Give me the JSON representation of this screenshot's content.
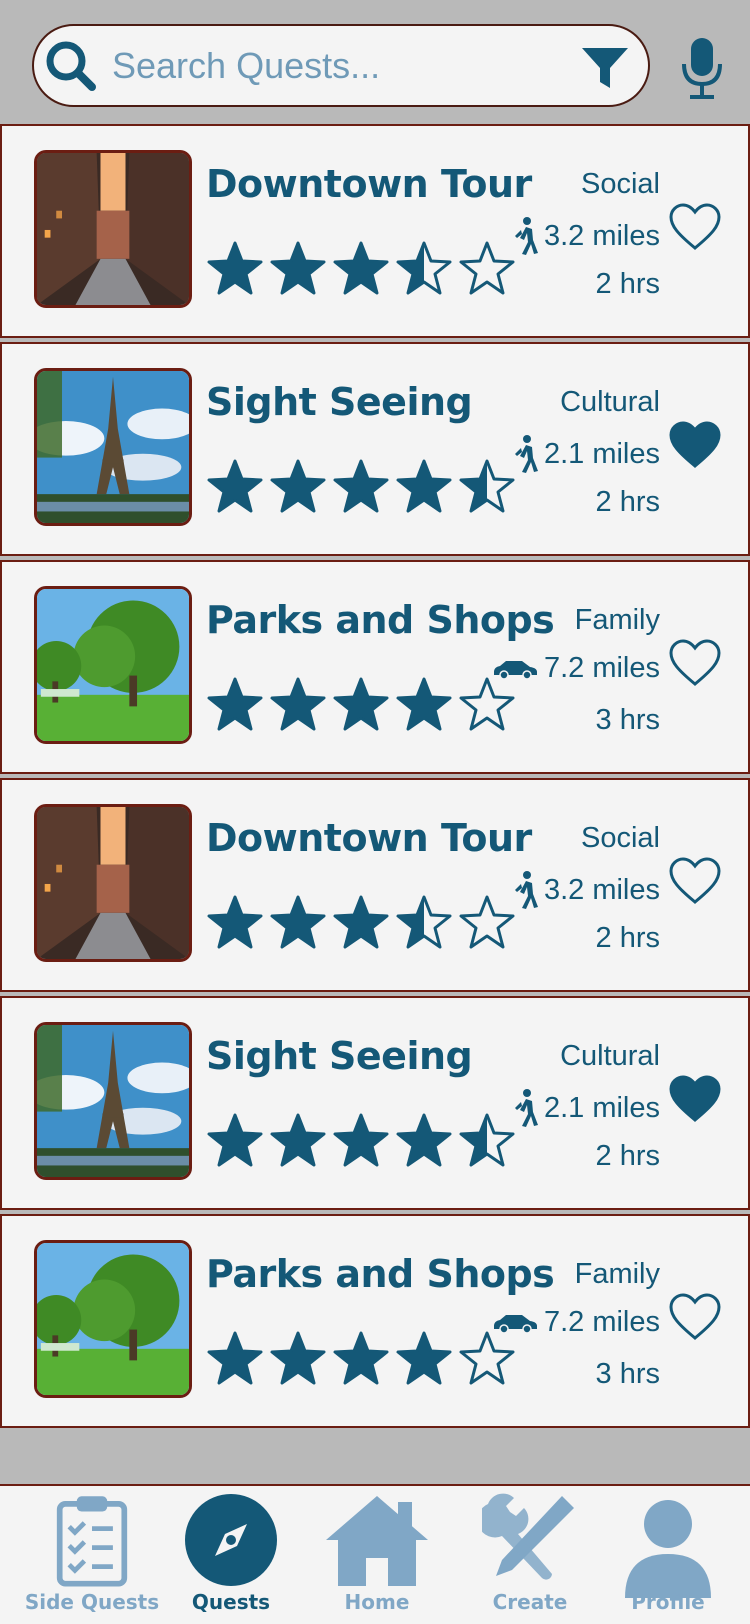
{
  "search": {
    "placeholder": "Search Quests..."
  },
  "quests": [
    {
      "title": "Downtown Tour",
      "category": "Social",
      "distance": "3.2 miles",
      "mode": "walk-icon",
      "duration": "2 hrs",
      "rating": 3.5,
      "favorited": false,
      "image": "alley"
    },
    {
      "title": "Sight Seeing",
      "category": "Cultural",
      "distance": "2.1 miles",
      "mode": "walk-icon",
      "duration": "2 hrs",
      "rating": 4.5,
      "favorited": true,
      "image": "tower"
    },
    {
      "title": "Parks and Shops",
      "category": "Family",
      "distance": "7.2 miles",
      "mode": "car-icon",
      "duration": "3 hrs",
      "rating": 4,
      "favorited": false,
      "image": "park"
    },
    {
      "title": "Downtown Tour",
      "category": "Social",
      "distance": "3.2 miles",
      "mode": "walk-icon",
      "duration": "2 hrs",
      "rating": 3.5,
      "favorited": false,
      "image": "alley"
    },
    {
      "title": "Sight Seeing",
      "category": "Cultural",
      "distance": "2.1 miles",
      "mode": "walk-icon",
      "duration": "2 hrs",
      "rating": 4.5,
      "favorited": true,
      "image": "tower"
    },
    {
      "title": "Parks and Shops",
      "category": "Family",
      "distance": "7.2 miles",
      "mode": "car-icon",
      "duration": "3 hrs",
      "rating": 4,
      "favorited": false,
      "image": "park"
    }
  ],
  "nav": [
    {
      "label": "Side Quests",
      "icon": "clipboard-checklist-icon",
      "active": false
    },
    {
      "label": "Quests",
      "icon": "compass-icon",
      "active": true
    },
    {
      "label": "Home",
      "icon": "home-icon",
      "active": false
    },
    {
      "label": "Create",
      "icon": "tools-icon",
      "active": false
    },
    {
      "label": "Profile",
      "icon": "user-icon",
      "active": false
    }
  ],
  "colors": {
    "primary": "#145877",
    "inactive": "#80a7c6",
    "card": "#f4f4f4",
    "border": "#6b1d12",
    "background": "#b9b9b9"
  }
}
